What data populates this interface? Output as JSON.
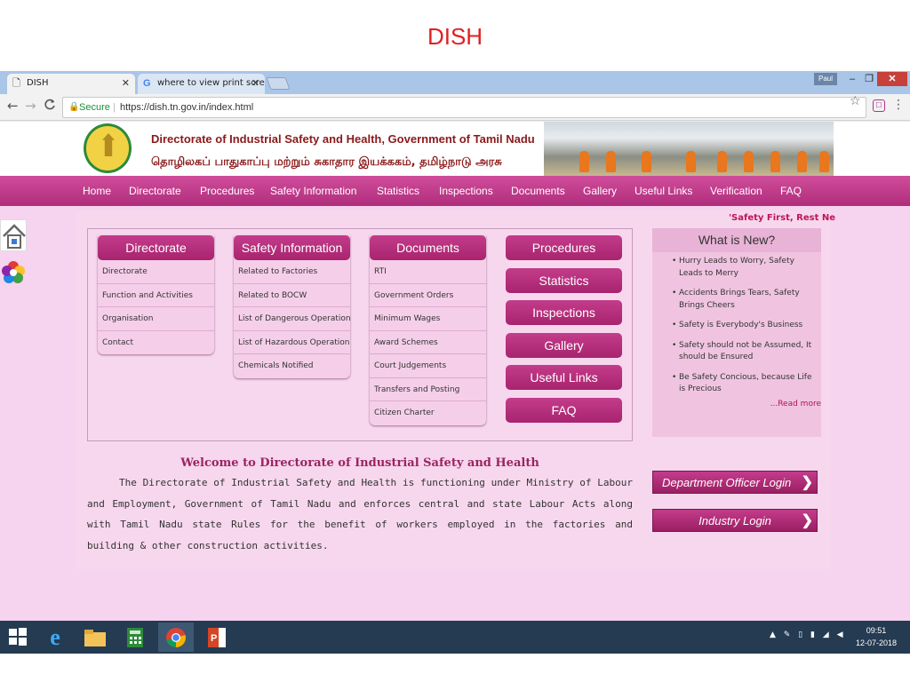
{
  "slide_title": "DISH",
  "browser": {
    "tabs": [
      {
        "label": "DISH",
        "icon": "document-icon",
        "close": "✕"
      },
      {
        "label": "where to view print scre",
        "icon": "google-icon",
        "close": "✕"
      }
    ],
    "user": "Paul",
    "window_controls": {
      "minimize": "–",
      "maximize": "❐",
      "close": "✕"
    },
    "nav": {
      "back": "←",
      "forward": "→",
      "reload": "C"
    },
    "security_label": "Secure",
    "url": "https://dish.tn.gov.in/index.html"
  },
  "site": {
    "org_name_en": "Directorate of Industrial Safety and Health, Government of Tamil Nadu",
    "org_name_ta": "தொழிலகப் பாதுகாப்பு மற்றும் சுகாதார இயக்ககம், தமிழ்நாடு அரசு",
    "menu": [
      "Home",
      "Directorate",
      "Procedures",
      "Safety Information",
      "Statistics",
      "Inspections",
      "Documents",
      "Gallery",
      "Useful Links",
      "Verification",
      "FAQ"
    ],
    "ticker": "'Safety First, Rest Ne",
    "panels": [
      {
        "title": "Directorate",
        "items": [
          "Directorate",
          "Function and Activities",
          "Organisation",
          "Contact"
        ]
      },
      {
        "title": "Safety Information",
        "items": [
          "Related to Factories",
          "Related to BOCW",
          "List of Dangerous Operations",
          "List of Hazardous Operations",
          "Chemicals Notified"
        ]
      },
      {
        "title": "Documents",
        "items": [
          "RTI",
          "Government Orders",
          "Minimum Wages",
          "Award Schemes",
          "Court Judgements",
          "Transfers and Posting",
          "Citizen Charter"
        ]
      }
    ],
    "quick_buttons": [
      "Procedures",
      "Statistics",
      "Inspections",
      "Gallery",
      "Useful Links",
      "FAQ"
    ],
    "news": {
      "title": "What is New?",
      "bullet": "•",
      "items": [
        "Hurry Leads to Worry, Safety Leads to Merry",
        "Accidents Brings Tears, Safety Brings Cheers",
        "Safety is Everybody's Business",
        "Safety should not be Assumed, It should be Ensured",
        "Be Safety Concious, because Life is Precious"
      ],
      "read_more": "...Read more"
    },
    "welcome_title": "Welcome to Directorate of Industrial Safety and Health",
    "welcome_text": "The Directorate of Industrial Safety and Health is functioning under Ministry of Labour and Employment, Government of Tamil Nadu and enforces central and state Labour Acts along with Tamil Nadu state Rules for the benefit of workers employed in the factories and building & other construction activities.",
    "logins": [
      {
        "label": "Department Officer Login",
        "chevron": "❯"
      },
      {
        "label": "Industry Login",
        "chevron": "❯"
      }
    ],
    "accent_color": "#b02d7c",
    "background_color": "#f6d3ee"
  },
  "taskbar": {
    "apps": [
      "windows-start-icon",
      "internet-explorer-icon",
      "file-explorer-icon",
      "calculator-icon",
      "chrome-icon",
      "powerpoint-icon"
    ],
    "tray_icons": "▲ ✎ ▯ ▮ ◢ ◀",
    "time": "09:51",
    "date": "12-07-2018"
  }
}
